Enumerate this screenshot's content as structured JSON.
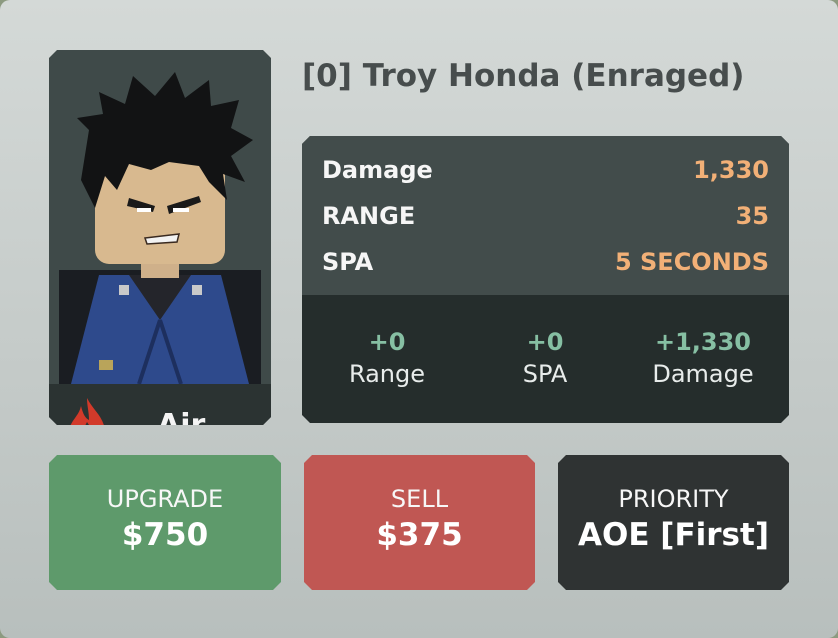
{
  "unit": {
    "name": "[0] Troy Honda (Enraged)",
    "element": "Air",
    "element_icon": "flame-icon"
  },
  "stats": [
    {
      "label": "Damage",
      "value": "1,330"
    },
    {
      "label": "RANGE",
      "value": "35"
    },
    {
      "label": "SPA",
      "value": "5 SECONDS"
    }
  ],
  "bonuses": [
    {
      "value": "+0",
      "label": "Range"
    },
    {
      "value": "+0",
      "label": "SPA"
    },
    {
      "value": "+1,330",
      "label": "Damage"
    }
  ],
  "buttons": {
    "upgrade": {
      "title": "UPGRADE",
      "value": "$750"
    },
    "sell": {
      "title": "SELL",
      "value": "$375"
    },
    "priority": {
      "title": "PRIORITY",
      "value": "AOE [First]"
    }
  },
  "colors": {
    "stat_value": "#f2b077",
    "bonus_value": "#86bfa3",
    "upgrade": "#5e9a6b",
    "sell": "#c05753",
    "priority": "#2f3333",
    "element_icon": "#d23a2a"
  }
}
